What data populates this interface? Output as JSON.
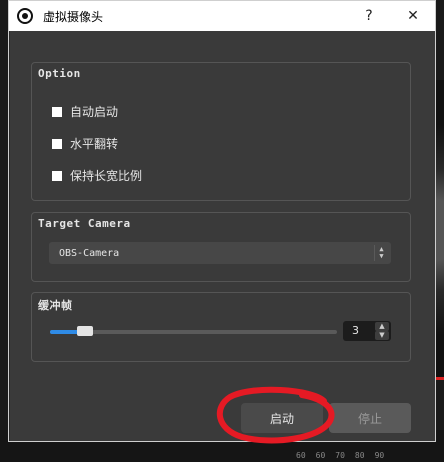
{
  "window": {
    "title": "虚拟摄像头",
    "help": "?",
    "close": "✕"
  },
  "option": {
    "group_title": "Option",
    "checkboxes": [
      {
        "label": "自动启动",
        "checked": false
      },
      {
        "label": "水平翻转",
        "checked": false
      },
      {
        "label": "保持长宽比例",
        "checked": false
      }
    ]
  },
  "target": {
    "group_title": "Target Camera",
    "selected": "OBS-Camera"
  },
  "buffer": {
    "group_title": "缓冲帧",
    "slider_fraction": 0.1,
    "value": "3"
  },
  "buttons": {
    "start": "启动",
    "stop": "停止"
  },
  "colors": {
    "accent": "#2f8be6",
    "annotation": "#e51a24",
    "panel": "#3a3a3a"
  },
  "background": {
    "ruler": [
      "60",
      "60",
      "70",
      "80",
      "90"
    ]
  }
}
